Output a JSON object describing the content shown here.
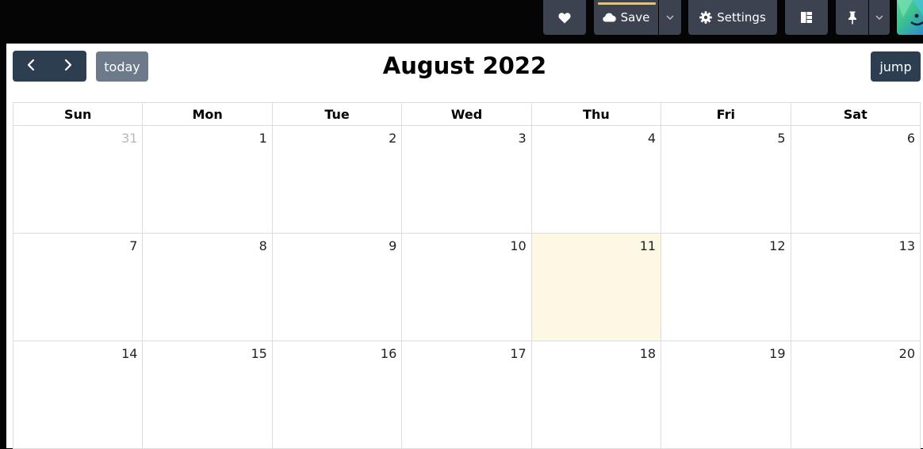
{
  "toolbar": {
    "save_label": "Save",
    "settings_label": "Settings",
    "icons": {
      "favorite": "heart-icon",
      "save": "cloud-icon",
      "save_dropdown": "chevron-down-icon",
      "settings": "gear-icon",
      "layout": "layout-icon",
      "pin": "pin-icon",
      "pin_dropdown": "chevron-down-icon"
    },
    "colors": {
      "button_bg": "#3c4250",
      "save_indicator": "#f6c344"
    }
  },
  "calendar": {
    "title": "August 2022",
    "today_label": "today",
    "jump_label": "jump",
    "weekdays": [
      "Sun",
      "Mon",
      "Tue",
      "Wed",
      "Thu",
      "Fri",
      "Sat"
    ],
    "weeks": [
      [
        "31",
        "1",
        "2",
        "3",
        "4",
        "5",
        "6"
      ],
      [
        "7",
        "8",
        "9",
        "10",
        "11",
        "12",
        "13"
      ],
      [
        "14",
        "15",
        "16",
        "17",
        "18",
        "19",
        "20"
      ]
    ],
    "today_date": "11",
    "colors": {
      "primary": "#2c3e50",
      "today_btn": "#6c7a89",
      "today_cell": "#fcf8e3"
    }
  }
}
